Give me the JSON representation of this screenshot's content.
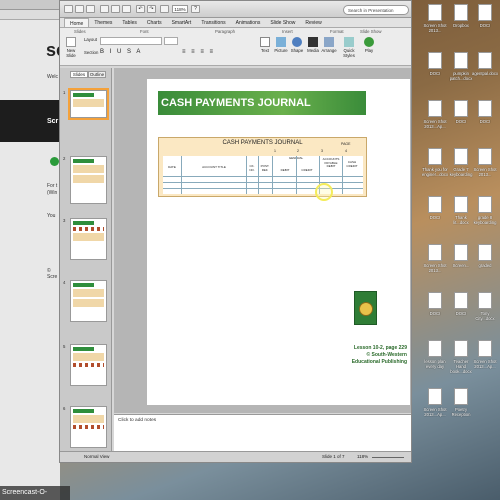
{
  "app": {
    "search_placeholder": "Search in Presentation",
    "zoom": "118%",
    "tabs": [
      "Home",
      "Themes",
      "Tables",
      "Charts",
      "SmartArt",
      "Transitions",
      "Animations",
      "Slide Show",
      "Review"
    ],
    "ribbon_groups": [
      "Slides",
      "Font",
      "Paragraph",
      "Insert",
      "Format",
      "Slide Show"
    ],
    "ribbon_buttons": [
      "New Slide",
      "Text",
      "Picture",
      "Shape",
      "Media",
      "Arrange",
      "Quick Styles",
      "Play"
    ],
    "layout_label": "Layout",
    "section_label": "Section"
  },
  "panel": {
    "tabs": [
      "Slides",
      "Outline"
    ],
    "slide_numbers": [
      "1",
      "2",
      "3",
      "4",
      "5",
      "6",
      "7"
    ],
    "last_thumb_text": "Transactions"
  },
  "slide": {
    "banner": "CASH PAYMENTS JOURNAL",
    "journal_title": "CASH PAYMENTS JOURNAL",
    "page_label": "PAGE",
    "col_numbers": [
      "1",
      "2",
      "3",
      "4"
    ],
    "headers": [
      "DATE",
      "ACCOUNT TITLE",
      "CK. NO.",
      "POST. REF.",
      "GENERAL",
      "DEBIT",
      "CREDIT",
      "ACCOUNTS PAYABLE DEBIT",
      "CASH CREDIT"
    ],
    "credit_lines": [
      "Lesson 10-2, page 229",
      "© South-Western",
      "Educational Publishing"
    ]
  },
  "notes": {
    "placeholder": "Click to add notes"
  },
  "status": {
    "view": "Normal View",
    "slide_info": "Slide 1 of 7",
    "zoom": "118%"
  },
  "browser": {
    "logo": "sc",
    "lines": [
      "Welc",
      "Scr",
      "For t",
      "(Win",
      "You",
      "© Scre"
    ]
  },
  "desktop_icons": [
    "Screen Shot 2013...",
    "Dropbox",
    "DOCI",
    "DOCI",
    "pumpkin patch...docx",
    "agentpal.docx",
    "Screen Shot 2013...Ap...",
    "DOCI",
    "DOCI",
    "Thank you for enginer...docx",
    "Grade 7 keyboarding",
    "Screen Shot 2013...",
    "DOCI",
    "Thank lit...docx",
    "grade 8 keyboarding",
    "Screen Shot 2013...",
    "Screen...",
    "graded",
    "DOCI",
    "DOCI",
    "Tony City...docx",
    "lesson plan every day",
    "Teacher Hand book...docx",
    "Screen Shot 2013...Ap...",
    "Screen Shot 2013...Ap...",
    "Poetry Reception"
  ],
  "watermark": "Screencast-O-Matic.com"
}
